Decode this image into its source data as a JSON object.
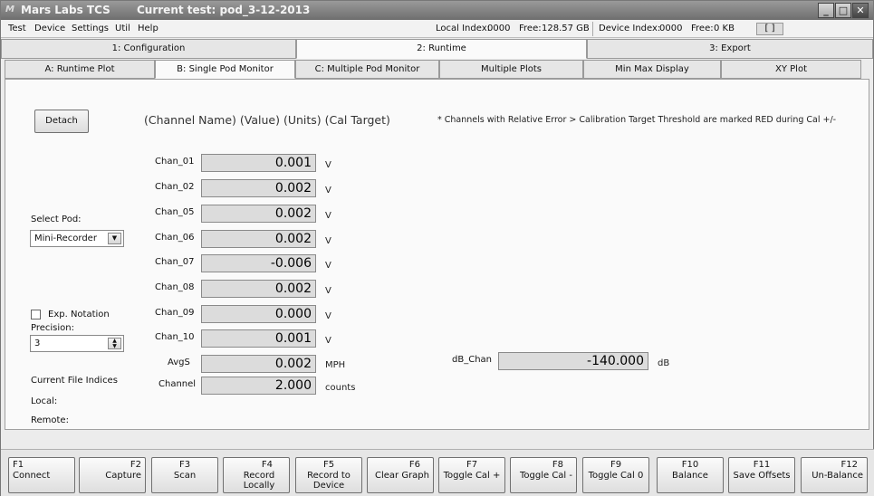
{
  "window": {
    "logo": "M",
    "app_title": "Mars Labs TCS",
    "test_title": "Current test: pod_3-12-2013",
    "minimize": "_",
    "maximize": "□",
    "close": "✕"
  },
  "menu": {
    "items": [
      "Test",
      "Device",
      "Settings",
      "Util",
      "Help"
    ],
    "local_index_label": "Local Index:",
    "local_index_value": "0000",
    "local_free_label": "Free:",
    "local_free_value": "128.57 GB",
    "device_index_label": "Device Index:",
    "device_index_value": "0000",
    "device_free_label": "Free:",
    "device_free_value": "0 KB",
    "bracket": "[ ]"
  },
  "main_tabs": [
    "1: Configuration",
    "2: Runtime",
    "3: Export"
  ],
  "sub_tabs": [
    "A: Runtime Plot",
    "B: Single Pod Monitor",
    "C: Multiple Pod Monitor",
    "Multiple Plots",
    "Min Max Display",
    "XY Plot"
  ],
  "panel": {
    "detach_label": "Detach",
    "header": "(Channel Name)  (Value)  (Units)  (Cal Target)",
    "note": "* Channels with Relative Error > Calibration Target Threshold are marked RED during Cal +/-",
    "select_pod_label": "Select Pod:",
    "select_pod_value": "Mini-Recorder",
    "exp_notation_label": "Exp. Notation",
    "precision_label": "Precision:",
    "precision_value": "3",
    "current_file_indices": "Current File Indices",
    "local_label": "Local:",
    "remote_label": "Remote:",
    "channels": [
      {
        "name": "Chan_01",
        "value": "0.001",
        "unit": "V"
      },
      {
        "name": "Chan_02",
        "value": "0.002",
        "unit": "V"
      },
      {
        "name": "Chan_05",
        "value": "0.002",
        "unit": "V"
      },
      {
        "name": "Chan_06",
        "value": "0.002",
        "unit": "V"
      },
      {
        "name": "Chan_07",
        "value": "-0.006",
        "unit": "V"
      },
      {
        "name": "Chan_08",
        "value": "0.002",
        "unit": "V"
      },
      {
        "name": "Chan_09",
        "value": "0.000",
        "unit": "V"
      },
      {
        "name": "Chan_10",
        "value": "0.001",
        "unit": "V"
      }
    ],
    "avgs": {
      "name": "AvgS",
      "value": "0.002",
      "unit": "MPH"
    },
    "channel": {
      "name": "Channel",
      "value": "2.000",
      "unit": "counts"
    },
    "db_chan": {
      "name": "dB_Chan",
      "value": "-140.000",
      "unit": "dB"
    }
  },
  "function_keys": [
    {
      "key": "F1",
      "label": "Connect"
    },
    {
      "key": "F2",
      "label": "Capture"
    },
    {
      "key": "F3",
      "label": "Scan"
    },
    {
      "key": "F4",
      "label": "Record Locally"
    },
    {
      "key": "F5",
      "label": "Record to Device"
    },
    {
      "key": "F6",
      "label": "Clear Graph"
    },
    {
      "key": "F7",
      "label": "Toggle Cal +"
    },
    {
      "key": "F8",
      "label": "Toggle Cal -"
    },
    {
      "key": "F9",
      "label": "Toggle Cal 0"
    },
    {
      "key": "F10",
      "label": "Balance"
    },
    {
      "key": "F11",
      "label": "Save Offsets"
    },
    {
      "key": "F12",
      "label": "Un-Balance"
    }
  ]
}
